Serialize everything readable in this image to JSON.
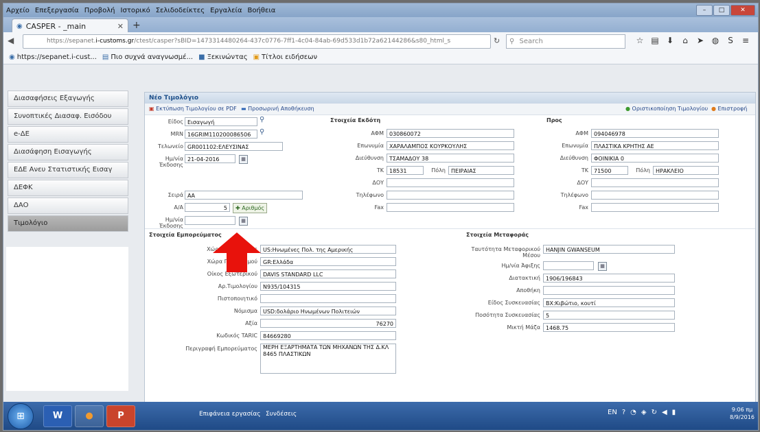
{
  "menu": [
    "Αρχείο",
    "Επεξεργασία",
    "Προβολή",
    "Ιστορικό",
    "Σελιδοδείκτες",
    "Εργαλεία",
    "Βοήθεια"
  ],
  "tab": {
    "title": "CASPER - _main"
  },
  "nav": {
    "url_prefix": "https://sepanet.",
    "url_domain": "i-customs.gr",
    "url_path": "/ctest/casper?sBID=1473314480264-437c0776-7ff1-4c04-84ab-69d533d1b72a62144286&s80_html_s",
    "search_placeholder": "Search"
  },
  "bookmarks": [
    "https://sepanet.i-cust...",
    "Πιο συχνά αναγνωσμέ...",
    "Ξεκινώντας",
    "Τίτλοι ειδήσεων"
  ],
  "sidebar": {
    "items": [
      {
        "label": "Διασαφήσεις Εξαγωγής"
      },
      {
        "label": "Συνοπτικές Διασαφ. Εισόδου"
      },
      {
        "label": "e-ΔΕ"
      },
      {
        "label": "Διασάφηση Εισαγωγής"
      },
      {
        "label": "ΕΔΕ Ανευ Στατιστικής Εισαγ"
      },
      {
        "label": "ΔΕΦΚ"
      },
      {
        "label": "ΔΑΟ"
      },
      {
        "label": "Τιμολόγιο"
      }
    ]
  },
  "panel": {
    "title": "Νέο Τιμολόγιο",
    "toolbar": {
      "pdf_label": "Εκτύπωση Τιμολογίου σε PDF",
      "save_label": "Προσωρινή Αποθήκευση",
      "finalize_label": "Οριστικοποίηση Τιμολογίου",
      "return_label": "Επιστροφή"
    },
    "invoice": {
      "type_label": "Είδος",
      "type_value": "Εισαγωγή",
      "mrn_label": "MRN",
      "mrn_value": "16GRIM110200086506",
      "office_label": "Τελωνείο",
      "office_value": "GR001102:ΕΛΕΥΣΙΝΑΣ",
      "date_label": "Ημ/νία Έκδοσης",
      "date_value": "21-04-2016",
      "series_label": "Σειρά",
      "series_value": "ΑΑ",
      "aa_label": "Α/Α",
      "aa_value": "5",
      "number_button": "Αριθμός",
      "date2_label": "Ημ/νία Έκδοσης"
    },
    "issuer": {
      "section": "Στοιχεία Εκδότη",
      "afm_label": "ΑΦΜ",
      "afm_value": "030860072",
      "name_label": "Επωνυμία",
      "name_value": "ΧΑΡΑΛΑΜΠΟΣ ΚΟΥΡΚΟΥΛΗΣ",
      "address_label": "Διεύθυνση",
      "address_value": "ΤΣΑΜΑΔΟΥ 38",
      "tk_label": "ΤΚ",
      "tk_value": "18531",
      "city_label": "Πόλη",
      "city_value": "ΠΕΙΡΑΙΑΣ",
      "doy_label": "ΔΟΥ",
      "phone_label": "Τηλέφωνο",
      "fax_label": "Fax"
    },
    "recipient": {
      "section": "Προς",
      "afm_label": "ΑΦΜ",
      "afm_value": "094046978",
      "name_label": "Επωνυμία",
      "name_value": "ΠΛΑΣΤΙΚΑ ΚΡΗΤΗΣ ΑΕ",
      "address_label": "Διεύθυνση",
      "address_value": "ΦΟΙΝΙΚΙΑ 0",
      "tk_label": "ΤΚ",
      "tk_value": "71500",
      "city_label": "Πόλη",
      "city_value": "ΗΡΑΚΛΕΙΟ",
      "doy_label": "ΔΟΥ",
      "phone_label": "Τηλέφωνο",
      "fax_label": "Fax"
    },
    "goods": {
      "section": "Στοιχεία Εμπορεύματος",
      "origin_label": "Χώρα Προέλευσης",
      "origin_value": "US:Ηνωμένες Πολ. της Αμερικής",
      "dest_label": "Χώρα Προορισμού",
      "dest_value": "GR:Ελλάδα",
      "foreign_house_label": "Οίκος Εξωτερικού",
      "foreign_house_value": "DAVIS STANDARD LLC",
      "invoice_no_label": "Αρ.Τιμολογίου",
      "invoice_no_value": "N935/104315",
      "cert_label": "Πιστοποιητικό",
      "currency_label": "Νόμισμα",
      "currency_value": "USD:δολάριο Ηνωμένων Πολιτειών",
      "value_label": "Αξία",
      "value_value": "76270",
      "taric_label": "Κωδικός TARIC",
      "taric_value": "84669280",
      "desc_label": "Περιγραφή Εμπορεύματος",
      "desc_value": "ΜΕΡΗ ΕΞΑΡΤΗΜΑΤΑ ΤΩΝ ΜΗΧΑΝΩΝ ΤΗΣ Δ.ΚΛ 8465 ΠΛΑΣΤΙΚΩΝ"
    },
    "transport": {
      "section": "Στοιχεία Μεταφοράς",
      "vehicle_label": "Ταυτότητα Μεταφορικού Μέσου",
      "vehicle_value": "HANJIN GWANSEUM",
      "arrival_label": "Ημ/νία Άφιξης",
      "bl_label": "Διατακτική",
      "bl_value": "1906/196843",
      "warehouse_label": "Αποθήκη",
      "pkg_type_label": "Είδος Συσκευασίας",
      "pkg_type_value": "BX:Κιβώτιο, κουτί",
      "pkg_qty_label": "Ποσότητα Συσκευασίας",
      "pkg_qty_value": "5",
      "gross_label": "Μικτή Μάζα",
      "gross_value": "1468.75"
    }
  },
  "taskbar": {
    "desktop_label": "Επιφάνεια εργασίας",
    "links_label": "Συνδέσεις",
    "lang": "EN",
    "time": "9:06 πμ",
    "date": "8/9/2016"
  },
  "colors": {
    "arrow": "#e8120c",
    "panel_title": "#1d4f8a"
  }
}
